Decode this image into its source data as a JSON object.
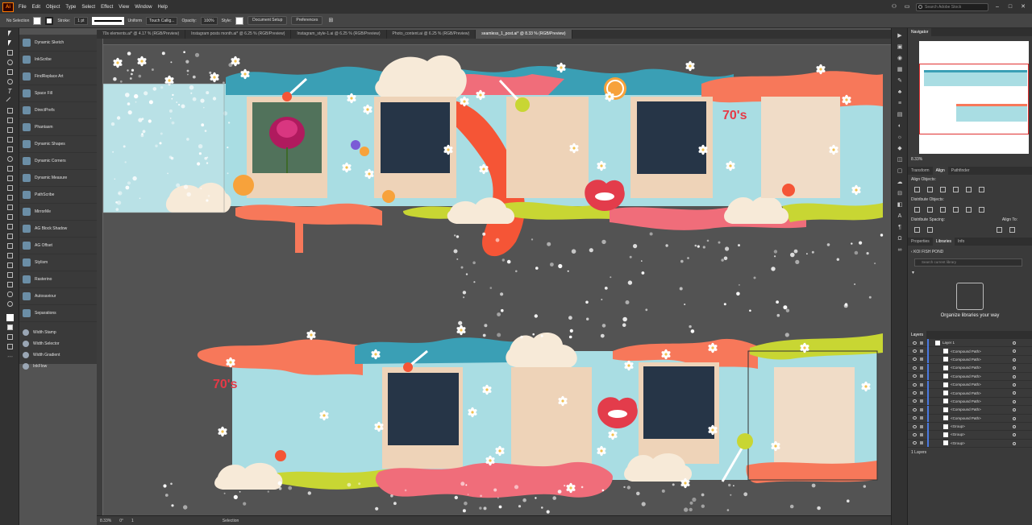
{
  "menubar": {
    "app_logo": "Ai",
    "items": [
      "File",
      "Edit",
      "Object",
      "Type",
      "Select",
      "Effect",
      "View",
      "Window",
      "Help"
    ],
    "search_placeholder": "Search Adobe Stock"
  },
  "control_bar": {
    "selection_label": "No Selection",
    "stroke_label": "Stroke:",
    "stroke_weight": "1 pt",
    "stroke_profile": "Uniform",
    "brush": "Touch Callig...",
    "opacity_label": "Opacity:",
    "opacity_value": "100%",
    "style_label": "Style:",
    "document_setup": "Document Setup",
    "preferences": "Preferences"
  },
  "document_tabs": [
    {
      "label": "70s elements.ai* @ 4.17 % (RGB/Preview)",
      "active": false
    },
    {
      "label": "Instagram posts month.ai* @ 6.25 % (RGB/Preview)",
      "active": false
    },
    {
      "label": "Instagram_style-1.ai @ 6.25 % (RGB/Preview)",
      "active": false
    },
    {
      "label": "Photo_content.ai @ 6.25 % (RGB/Preview)",
      "active": false
    },
    {
      "label": "seamless_1_post.ai* @ 8.33 % (RGB/Preview)",
      "active": true
    }
  ],
  "plugins": [
    "Dynamic Sketch",
    "InkScribe",
    "FindReplace Art",
    "Space Fill",
    "DirectPrefs",
    "Phantasm",
    "Dynamic Shapes",
    "Dynamic Corners",
    "Dynamic Measure",
    "PathScribe",
    "MirrorMe",
    "AG Block Shadow",
    "AG Offset",
    "Stylism",
    "Rasterino",
    "Autosaviour",
    "Separations"
  ],
  "plugins_small": [
    "Width Stamp",
    "Width Selector",
    "Width Gradient",
    "InkFlow"
  ],
  "status_bar": {
    "zoom": "8.33%",
    "rotation": "0°",
    "artboard": "1",
    "tool": "Selection"
  },
  "navigator": {
    "title": "Navigator",
    "zoom": "8.33%"
  },
  "align_panel": {
    "tabs": [
      "Transform",
      "Align",
      "Pathfinder"
    ],
    "active_tab": "Align",
    "align_objects": "Align Objects:",
    "distribute_objects": "Distribute Objects:",
    "distribute_spacing": "Distribute Spacing:",
    "align_to": "Align To:"
  },
  "libraries_panel": {
    "tabs": [
      "Properties",
      "Libraries",
      "Info"
    ],
    "active_tab": "Libraries",
    "library_name": "KOI FISH POND",
    "search_placeholder": "Search current library",
    "empty_text": "Organize libraries your way"
  },
  "layers_panel": {
    "title": "Layers",
    "rows": [
      {
        "label": "Layer 1",
        "level": 0
      },
      {
        "label": "<Compound Path>",
        "level": 1
      },
      {
        "label": "<Compound Path>",
        "level": 1
      },
      {
        "label": "<Compound Path>",
        "level": 1
      },
      {
        "label": "<Compound Path>",
        "level": 1
      },
      {
        "label": "<Compound Path>",
        "level": 1
      },
      {
        "label": "<Compound Path>",
        "level": 1
      },
      {
        "label": "<Compound Path>",
        "level": 1
      },
      {
        "label": "<Compound Path>",
        "level": 1
      },
      {
        "label": "<Compound Path>",
        "level": 1
      },
      {
        "label": "<Group>",
        "level": 1
      },
      {
        "label": "<Group>",
        "level": 1
      },
      {
        "label": "<Group>",
        "level": 1
      }
    ],
    "footer": "1 Layers"
  },
  "canvas": {
    "sticker_text": "70's"
  },
  "colors": {
    "teal": "#3a9fb5",
    "light_blue": "#a9dde3",
    "coral": "#f7785a",
    "pink": "#f06d7a",
    "cream": "#f7ead8",
    "frame": "#eed3b8",
    "dark_photo": "#263547",
    "lime": "#c8d633"
  }
}
